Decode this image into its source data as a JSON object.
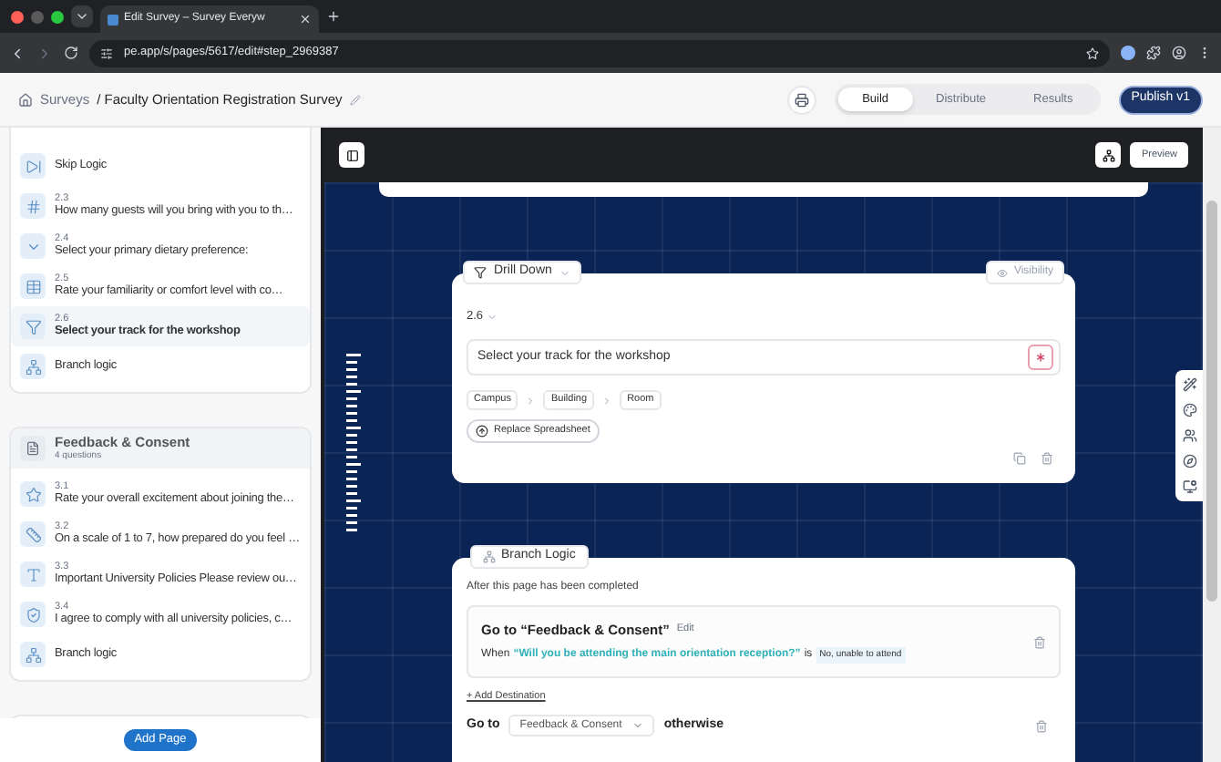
{
  "browser": {
    "tab_title": "Edit Survey – Survey Everyw",
    "url": "pe.app/s/pages/5617/edit#step_2969387"
  },
  "header": {
    "breadcrumb_root": "Surveys",
    "survey_title": "/ Faculty Orientation Registration Survey",
    "tabs": [
      {
        "label": "Build",
        "selected": true
      },
      {
        "label": "Distribute",
        "selected": false
      },
      {
        "label": "Results",
        "selected": false
      }
    ],
    "publish": "Publish v1"
  },
  "sidebar": {
    "sections": [
      {
        "items": [
          {
            "kind": "skip_logic",
            "text": "Skip Logic",
            "selected": false
          },
          {
            "kind": "number",
            "number": "2.3",
            "text": "How many guests will you bring with you to th…",
            "selected": false
          },
          {
            "kind": "dropdown",
            "number": "2.4",
            "text": "Select your primary dietary preference:",
            "selected": false
          },
          {
            "kind": "matrix",
            "number": "2.5",
            "text": "Rate your familiarity or comfort level with co…",
            "selected": false
          },
          {
            "kind": "drill_down",
            "number": "2.6",
            "text": "Select your track for the workshop",
            "selected": true
          },
          {
            "kind": "branch_logic",
            "text": "Branch logic",
            "selected": false
          }
        ]
      },
      {
        "title": "Feedback & Consent",
        "subtitle": "4 questions",
        "items": [
          {
            "kind": "rating",
            "number": "3.1",
            "text": "Rate your overall excitement about joining the…",
            "selected": false
          },
          {
            "kind": "scale",
            "number": "3.2",
            "text": "On a scale of 1 to 7, how prepared do you feel …",
            "selected": false
          },
          {
            "kind": "text",
            "number": "3.3",
            "text": "Important University Policies Please review ou…",
            "selected": false
          },
          {
            "kind": "consent",
            "number": "3.4",
            "text": "I agree to comply with all university policies, c…",
            "selected": false
          },
          {
            "kind": "branch_logic",
            "text": "Branch logic",
            "selected": false
          }
        ]
      }
    ],
    "add_page": "Add Page"
  },
  "canvas": {
    "preview": "Preview",
    "question_card": {
      "type": "Drill Down",
      "visibility": "Visibility",
      "number": "2.6",
      "question": "Select your track for the workshop",
      "required": true,
      "levels": [
        "Campus",
        "Building",
        "Room"
      ],
      "replace": "Replace Spreadsheet"
    },
    "branch_card": {
      "title": "Branch Logic",
      "intro": "After this page has been completed",
      "rules": [
        {
          "goto": "Go to “Feedback & Consent”",
          "edit": "Edit",
          "when": "When",
          "question": "“Will you be attending the main orientation reception?”",
          "is": "is",
          "answer": "No, unable to attend"
        }
      ],
      "add_destination": "+ Add Destination",
      "otherwise_goto": "Go to",
      "otherwise_target": "Feedback & Consent",
      "otherwise": "otherwise"
    }
  }
}
